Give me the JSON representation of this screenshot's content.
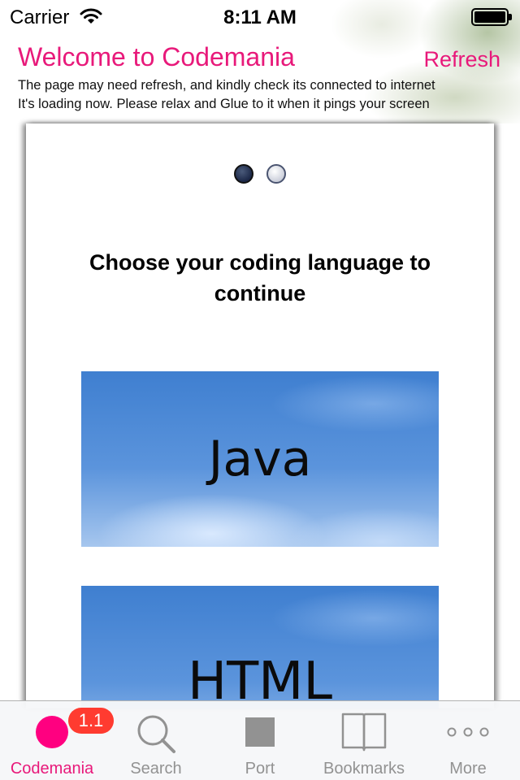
{
  "status_bar": {
    "carrier": "Carrier",
    "time": "8:11 AM"
  },
  "header": {
    "title": "Welcome to Codemania",
    "refresh_label": "Refresh",
    "info_line_1": "The page may need refresh, and kindly check its connected to internet",
    "info_line_2": "It's loading now. Please relax and Glue to it when it pings your screen"
  },
  "card": {
    "page_indicator": {
      "current": 1,
      "total": 2
    },
    "prompt": "Choose your coding language to continue",
    "languages": [
      {
        "label": "Java"
      },
      {
        "label": "HTML"
      }
    ]
  },
  "tab_bar": {
    "tabs": [
      {
        "label": "Codemania",
        "icon": "circle-icon",
        "selected": true,
        "badge": "1.1"
      },
      {
        "label": "Search",
        "icon": "search-icon",
        "selected": false
      },
      {
        "label": "Port",
        "icon": "square-icon",
        "selected": false
      },
      {
        "label": "Bookmarks",
        "icon": "book-icon",
        "selected": false
      },
      {
        "label": "More",
        "icon": "more-icon",
        "selected": false
      }
    ]
  },
  "colors": {
    "accent": "#e8197a",
    "tab_selected_icon": "#ff0080",
    "badge": "#ff3b30",
    "tab_inactive": "#929292"
  }
}
